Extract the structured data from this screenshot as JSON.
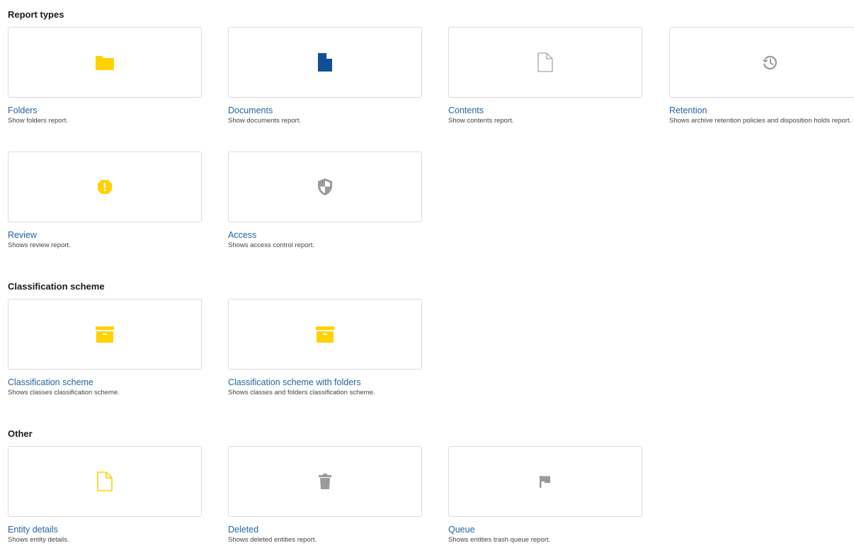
{
  "sections": {
    "report_types": {
      "title": "Report types",
      "tiles": [
        {
          "title": "Folders",
          "description": "Show folders report.",
          "icon": "folder-icon",
          "icon_color": "#ffd200"
        },
        {
          "title": "Documents",
          "description": "Show documents report.",
          "icon": "document-icon",
          "icon_color": "#0f4f97"
        },
        {
          "title": "Contents",
          "description": "Show contents report.",
          "icon": "file-outline-icon",
          "icon_color": "#b5b5b5"
        },
        {
          "title": "Retention",
          "description": "Shows archive retention policies and disposition holds report.",
          "icon": "history-icon",
          "icon_color": "#9a9a9a"
        },
        {
          "title": "Review",
          "description": "Shows review report.",
          "icon": "alert-octagon-icon",
          "icon_color": "#ffd200"
        },
        {
          "title": "Access",
          "description": "Shows access control report.",
          "icon": "shield-icon",
          "icon_color": "#9a9a9a"
        }
      ]
    },
    "classification_scheme": {
      "title": "Classification scheme",
      "tiles": [
        {
          "title": "Classification scheme",
          "description": "Shows classes classification scheme.",
          "icon": "archive-box-icon",
          "icon_color": "#ffd200"
        },
        {
          "title": "Classification scheme with folders",
          "description": "Shows classes and folders classification scheme.",
          "icon": "archive-box-icon",
          "icon_color": "#ffd200"
        }
      ]
    },
    "other": {
      "title": "Other",
      "tiles": [
        {
          "title": "Entity details",
          "description": "Shows entity details.",
          "icon": "file-outline-icon",
          "icon_color": "#ffd200"
        },
        {
          "title": "Deleted",
          "description": "Shows deleted entities report.",
          "icon": "trash-icon",
          "icon_color": "#9a9a9a"
        },
        {
          "title": "Queue",
          "description": "Shows entities trash queue report.",
          "icon": "flag-icon",
          "icon_color": "#9a9a9a"
        }
      ]
    }
  }
}
